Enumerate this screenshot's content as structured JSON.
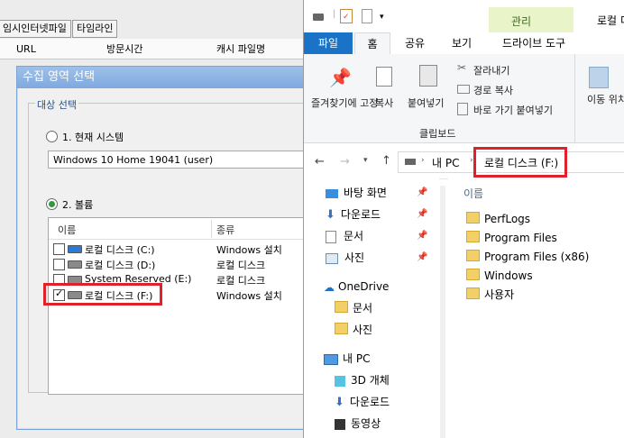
{
  "background_app": {
    "tabs": [
      "임시인터넷파일",
      "타임라인"
    ],
    "columns": [
      "URL",
      "방문시간",
      "캐시 파일명"
    ]
  },
  "dialog": {
    "title": "수집 영역 선택",
    "group_label": "대상 선택",
    "option_current": "1. 현재 시스템",
    "system_value": "Windows 10 Home 19041 (user)",
    "option_volume": "2. 볼륨",
    "list_headers": {
      "name": "이름",
      "type": "종류"
    },
    "volumes": [
      {
        "name": "로컬 디스크 (C:)",
        "type": "Windows 설치",
        "checked": false
      },
      {
        "name": "로컬 디스크 (D:)",
        "type": "로컬 디스크",
        "checked": false
      },
      {
        "name": "System Reserved (E:)",
        "type": "로컬 디스크",
        "checked": false
      },
      {
        "name": "로컬 디스크 (F:)",
        "type": "Windows 설치",
        "checked": true
      }
    ]
  },
  "explorer": {
    "title_partial": "로컬 디",
    "context_tab_group": "관리",
    "tabs": {
      "file": "파일",
      "home": "홈",
      "share": "공유",
      "view": "보기",
      "drive_tools": "드라이브 도구"
    },
    "ribbon": {
      "pin": "즐겨찾기에 고정",
      "copy": "복사",
      "paste": "붙여넣기",
      "cut": "잘라내기",
      "copy_path": "경로 복사",
      "paste_shortcut": "바로 가기 붙여넣기",
      "move_to": "이동 위치",
      "group_clipboard": "클립보드"
    },
    "address": {
      "root": "내 PC",
      "current": "로컬 디스크 (F:)"
    },
    "nav": {
      "desktop": "바탕 화면",
      "downloads": "다운로드",
      "documents": "문서",
      "pictures": "사진",
      "onedrive": "OneDrive",
      "od_documents": "문서",
      "od_pictures": "사진",
      "this_pc": "내 PC",
      "objects3d": "3D 개체",
      "pc_downloads": "다운로드",
      "videos": "동영상"
    },
    "file_header": "이름",
    "files": [
      "PerfLogs",
      "Program Files",
      "Program Files (x86)",
      "Windows",
      "사용자"
    ]
  }
}
